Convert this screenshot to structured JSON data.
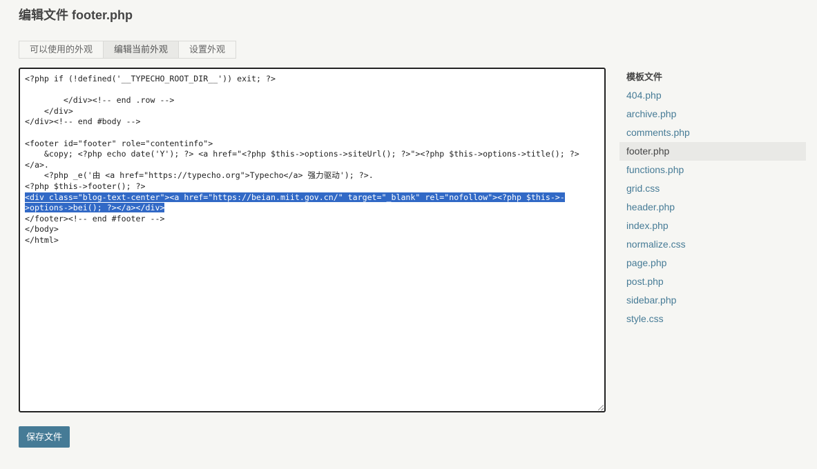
{
  "header": {
    "title": "编辑文件 footer.php"
  },
  "tabs": [
    {
      "label": "可以使用的外观",
      "active": false
    },
    {
      "label": "编辑当前外观",
      "active": true
    },
    {
      "label": "设置外观",
      "active": false
    }
  ],
  "editor": {
    "lines": [
      "<?php if (!defined('__TYPECHO_ROOT_DIR__')) exit; ?>",
      "",
      "        </div><!-- end .row -->",
      "    </div>",
      "</div><!-- end #body -->",
      "",
      "<footer id=\"footer\" role=\"contentinfo\">",
      "    &copy; <?php echo date('Y'); ?> <a href=\"<?php $this->options->siteUrl(); ?>\"><?php $this->options->title(); ?>",
      "</a>.",
      "    <?php _e('由 <a href=\"https://typecho.org\">Typecho</a> 强力驱动'); ?>.",
      "<?php $this->footer(); ?>",
      "<div class=\"blog-text-center\"><a href=\"https://beian.miit.gov.cn/\" target=\"_blank\" rel=\"nofollow\"><?php $this->-",
      ">options->bei(); ?></a></div>",
      "</footer><!-- end #footer -->",
      "</body>",
      "</html>"
    ],
    "selected_lines": [
      11,
      12
    ]
  },
  "save_button": {
    "label": "保存文件"
  },
  "sidebar": {
    "heading": "模板文件",
    "files": [
      {
        "name": "404.php",
        "active": false
      },
      {
        "name": "archive.php",
        "active": false
      },
      {
        "name": "comments.php",
        "active": false
      },
      {
        "name": "footer.php",
        "active": true
      },
      {
        "name": "functions.php",
        "active": false
      },
      {
        "name": "grid.css",
        "active": false
      },
      {
        "name": "header.php",
        "active": false
      },
      {
        "name": "index.php",
        "active": false
      },
      {
        "name": "normalize.css",
        "active": false
      },
      {
        "name": "page.php",
        "active": false
      },
      {
        "name": "post.php",
        "active": false
      },
      {
        "name": "sidebar.php",
        "active": false
      },
      {
        "name": "style.css",
        "active": false
      }
    ]
  },
  "colors": {
    "accent": "#467b96",
    "selection": "#3169c6",
    "background": "#f6f6f3"
  }
}
